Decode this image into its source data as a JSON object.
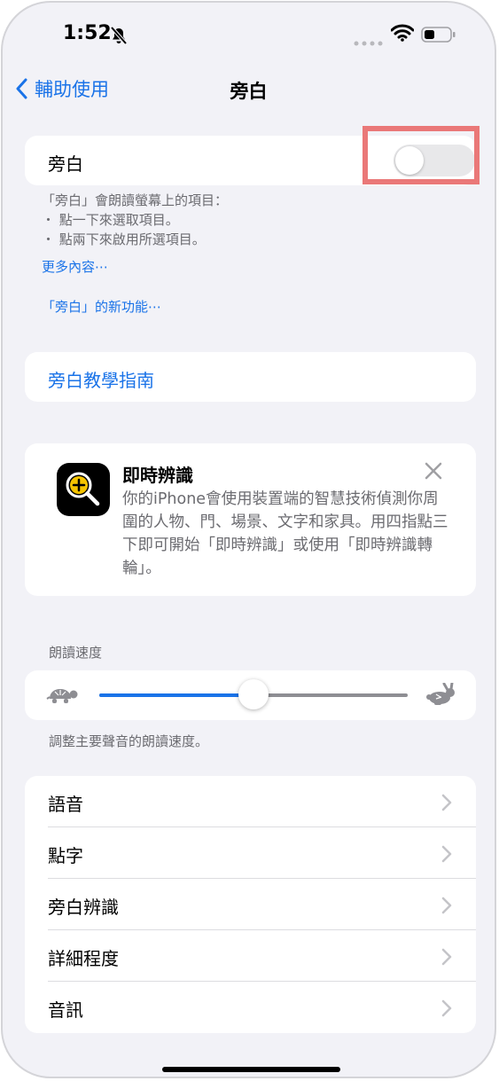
{
  "status": {
    "time": "1:52"
  },
  "nav": {
    "back_label": "輔助使用",
    "title": "旁白"
  },
  "voiceover": {
    "label": "旁白",
    "toggle_on": false,
    "desc_heading": "「旁白」會朗讀螢幕上的項目：",
    "bullets": [
      "・ 點一下來選取項目。",
      "・ 點兩下來啟用所選項目。"
    ],
    "more_link": "更多內容⋯",
    "whats_new_link": "「旁白」的新功能⋯"
  },
  "tutorial": {
    "label": "旁白教學指南"
  },
  "live_recognition": {
    "title": "即時辨識",
    "text": "你的iPhone會使用裝置端的智慧技術偵測你周圍的人物、門、場景、文字和家具。用四指點三下即可開始「即時辨識」或使用「即時辨識轉輪」。"
  },
  "speaking_rate": {
    "header": "朗讀速度",
    "value": 0.5,
    "footer": "調整主要聲音的朗讀速度。"
  },
  "menu": {
    "items": [
      {
        "label": "語音"
      },
      {
        "label": "點字"
      },
      {
        "label": "旁白辨識"
      },
      {
        "label": "詳細程度"
      },
      {
        "label": "音訊"
      }
    ]
  },
  "colors": {
    "accent": "#1a73e8",
    "highlight": "#ea7878"
  }
}
